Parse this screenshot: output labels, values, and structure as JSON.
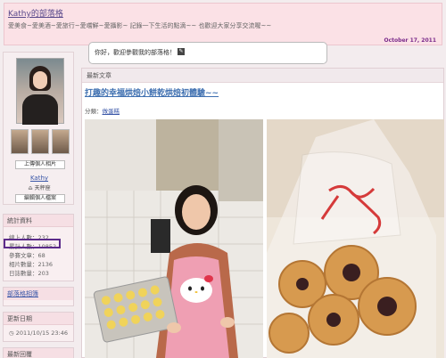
{
  "header": {
    "blog_title": "Kathy的部落格",
    "tagline": "愛美食~愛美酒~愛旅行~愛嚐鮮~愛攝影~ 記錄一下生活的點滴~~ 也歡迎大家分享交流喔~~",
    "date": "October 17, 2011"
  },
  "greeting": {
    "text": "你好，歡迎參觀我的部落格！"
  },
  "profile": {
    "upload_button": "上傳個人相片",
    "name": "Kathy",
    "weather": "天秤座",
    "edit_button": "編輯個人檔案"
  },
  "stats": {
    "title": "統計資料",
    "lines": [
      "線上人數：232",
      "累計人數：10852",
      "參賽文章：68",
      "相片數量：2136",
      "日誌數量：203"
    ]
  },
  "links": {
    "title": "部落格相簿"
  },
  "updated": {
    "title": "更新日期",
    "value": "2011/10/15 23:46"
  },
  "latest_reply": {
    "title": "最新回覆"
  },
  "main": {
    "section_title": "最新文章",
    "post_title": "打趣的幸福烘焙小餅乾烘焙初體驗~~",
    "category_label": "分類：",
    "category_value": "做蛋糕"
  }
}
